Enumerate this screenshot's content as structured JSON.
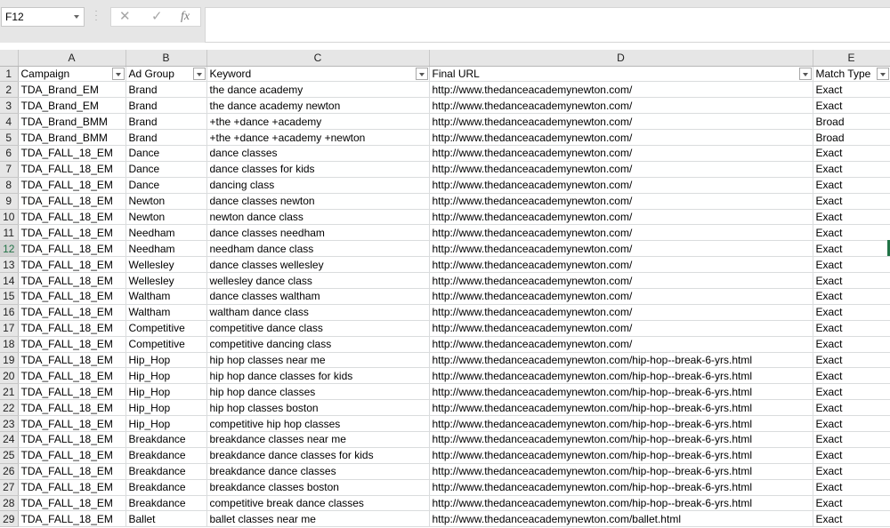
{
  "name_box": "F12",
  "formula_bar": {
    "cancel_icon": "close-icon",
    "enter_icon": "check-icon",
    "fx_label": "fx",
    "value": ""
  },
  "active_row": "12",
  "columns": [
    "A",
    "B",
    "C",
    "D",
    "E"
  ],
  "headers": [
    "Campaign",
    "Ad Group",
    "Keyword",
    "Final URL",
    "Match Type"
  ],
  "rows": [
    [
      "2",
      "TDA_Brand_EM",
      "Brand",
      "the dance academy",
      "http://www.thedanceacademynewton.com/",
      "Exact"
    ],
    [
      "3",
      "TDA_Brand_EM",
      "Brand",
      "the dance academy newton",
      "http://www.thedanceacademynewton.com/",
      "Exact"
    ],
    [
      "4",
      "TDA_Brand_BMM",
      "Brand",
      "+the +dance +academy",
      "http://www.thedanceacademynewton.com/",
      "Broad"
    ],
    [
      "5",
      "TDA_Brand_BMM",
      "Brand",
      "+the +dance +academy +newton",
      "http://www.thedanceacademynewton.com/",
      "Broad"
    ],
    [
      "6",
      "TDA_FALL_18_EM",
      "Dance",
      "dance classes",
      "http://www.thedanceacademynewton.com/",
      "Exact"
    ],
    [
      "7",
      "TDA_FALL_18_EM",
      "Dance",
      "dance classes for kids",
      "http://www.thedanceacademynewton.com/",
      "Exact"
    ],
    [
      "8",
      "TDA_FALL_18_EM",
      "Dance",
      "dancing class",
      "http://www.thedanceacademynewton.com/",
      "Exact"
    ],
    [
      "9",
      "TDA_FALL_18_EM",
      "Newton",
      "dance classes newton",
      "http://www.thedanceacademynewton.com/",
      "Exact"
    ],
    [
      "10",
      "TDA_FALL_18_EM",
      "Newton",
      "newton dance class",
      "http://www.thedanceacademynewton.com/",
      "Exact"
    ],
    [
      "11",
      "TDA_FALL_18_EM",
      "Needham",
      "dance classes needham",
      "http://www.thedanceacademynewton.com/",
      "Exact"
    ],
    [
      "12",
      "TDA_FALL_18_EM",
      "Needham",
      "needham dance class",
      "http://www.thedanceacademynewton.com/",
      "Exact"
    ],
    [
      "13",
      "TDA_FALL_18_EM",
      "Wellesley",
      "dance classes wellesley",
      "http://www.thedanceacademynewton.com/",
      "Exact"
    ],
    [
      "14",
      "TDA_FALL_18_EM",
      "Wellesley",
      "wellesley dance class",
      "http://www.thedanceacademynewton.com/",
      "Exact"
    ],
    [
      "15",
      "TDA_FALL_18_EM",
      "Waltham",
      "dance classes waltham",
      "http://www.thedanceacademynewton.com/",
      "Exact"
    ],
    [
      "16",
      "TDA_FALL_18_EM",
      "Waltham",
      "waltham dance class",
      "http://www.thedanceacademynewton.com/",
      "Exact"
    ],
    [
      "17",
      "TDA_FALL_18_EM",
      "Competitive",
      "competitive dance class",
      "http://www.thedanceacademynewton.com/",
      "Exact"
    ],
    [
      "18",
      "TDA_FALL_18_EM",
      "Competitive",
      "competitive dancing class",
      "http://www.thedanceacademynewton.com/",
      "Exact"
    ],
    [
      "19",
      "TDA_FALL_18_EM",
      "Hip_Hop",
      "hip hop classes near me",
      "http://www.thedanceacademynewton.com/hip-hop--break-6-yrs.html",
      "Exact"
    ],
    [
      "20",
      "TDA_FALL_18_EM",
      "Hip_Hop",
      "hip hop dance classes for kids",
      "http://www.thedanceacademynewton.com/hip-hop--break-6-yrs.html",
      "Exact"
    ],
    [
      "21",
      "TDA_FALL_18_EM",
      "Hip_Hop",
      "hip hop dance classes",
      "http://www.thedanceacademynewton.com/hip-hop--break-6-yrs.html",
      "Exact"
    ],
    [
      "22",
      "TDA_FALL_18_EM",
      "Hip_Hop",
      "hip hop classes boston",
      "http://www.thedanceacademynewton.com/hip-hop--break-6-yrs.html",
      "Exact"
    ],
    [
      "23",
      "TDA_FALL_18_EM",
      "Hip_Hop",
      "competitive hip hop classes",
      "http://www.thedanceacademynewton.com/hip-hop--break-6-yrs.html",
      "Exact"
    ],
    [
      "24",
      "TDA_FALL_18_EM",
      "Breakdance",
      "breakdance classes near me",
      "http://www.thedanceacademynewton.com/hip-hop--break-6-yrs.html",
      "Exact"
    ],
    [
      "25",
      "TDA_FALL_18_EM",
      "Breakdance",
      "breakdance dance classes for kids",
      "http://www.thedanceacademynewton.com/hip-hop--break-6-yrs.html",
      "Exact"
    ],
    [
      "26",
      "TDA_FALL_18_EM",
      "Breakdance",
      "breakdance dance classes",
      "http://www.thedanceacademynewton.com/hip-hop--break-6-yrs.html",
      "Exact"
    ],
    [
      "27",
      "TDA_FALL_18_EM",
      "Breakdance",
      "breakdance classes boston",
      "http://www.thedanceacademynewton.com/hip-hop--break-6-yrs.html",
      "Exact"
    ],
    [
      "28",
      "TDA_FALL_18_EM",
      "Breakdance",
      "competitive break dance classes",
      "http://www.thedanceacademynewton.com/hip-hop--break-6-yrs.html",
      "Exact"
    ],
    [
      "29",
      "TDA_FALL_18_EM",
      "Ballet",
      "ballet classes near me",
      "http://www.thedanceacademynewton.com/ballet.html",
      "Exact"
    ]
  ],
  "colors": {
    "accent": "#217346",
    "header_bg": "#e6e6e6",
    "gridline": "#dadcdd"
  }
}
